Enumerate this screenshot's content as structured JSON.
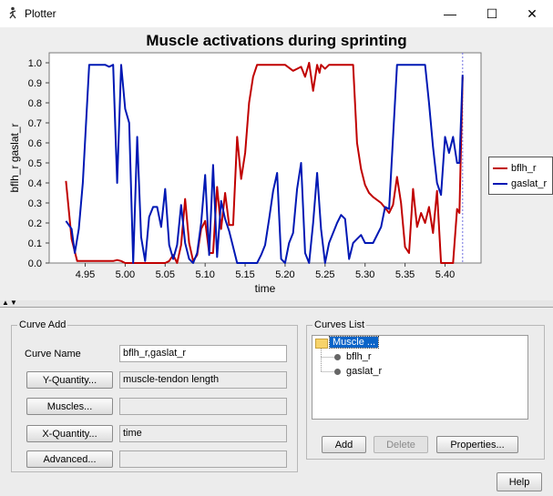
{
  "window": {
    "title": "Plotter",
    "minimize": "—",
    "maximize": "☐",
    "close": "✕"
  },
  "chart_data": {
    "type": "line",
    "title": "Muscle activations during sprinting",
    "xlabel": "time",
    "ylabel": "bflh_r gaslat_r",
    "xlim": [
      4.905,
      5.445
    ],
    "ylim": [
      0,
      1.05
    ],
    "xticks": [
      "4.95",
      "5.00",
      "5.05",
      "5.10",
      "5.15",
      "5.20",
      "5.25",
      "5.30",
      "5.35",
      "5.40"
    ],
    "yticks": [
      "0.0",
      "0.1",
      "0.2",
      "0.3",
      "0.4",
      "0.5",
      "0.6",
      "0.7",
      "0.8",
      "0.9",
      "1.0"
    ],
    "legend_position": "right",
    "cursor_x": 5.422,
    "series": [
      {
        "name": "bflh_r",
        "color": "#c00000",
        "x": [
          4.926,
          4.933,
          4.94,
          4.955,
          4.97,
          4.98,
          4.985,
          4.99,
          4.995,
          5.0,
          5.01,
          5.02,
          5.03,
          5.04,
          5.05,
          5.055,
          5.06,
          5.065,
          5.07,
          5.075,
          5.08,
          5.085,
          5.09,
          5.095,
          5.1,
          5.105,
          5.11,
          5.115,
          5.12,
          5.125,
          5.13,
          5.135,
          5.14,
          5.145,
          5.15,
          5.155,
          5.16,
          5.165,
          5.17,
          5.2,
          5.21,
          5.215,
          5.22,
          5.225,
          5.23,
          5.235,
          5.24,
          5.243,
          5.245,
          5.25,
          5.255,
          5.26,
          5.265,
          5.27,
          5.275,
          5.285,
          5.29,
          5.295,
          5.3,
          5.305,
          5.31,
          5.32,
          5.33,
          5.335,
          5.34,
          5.345,
          5.35,
          5.355,
          5.36,
          5.365,
          5.37,
          5.375,
          5.38,
          5.385,
          5.39,
          5.395,
          5.4,
          5.405,
          5.41,
          5.415,
          5.418,
          5.422
        ],
        "y": [
          0.41,
          0.12,
          0.01,
          0.01,
          0.01,
          0.01,
          0.01,
          0.015,
          0.01,
          0.0,
          0.0,
          0.0,
          0.0,
          0.0,
          0.0,
          0.01,
          0.04,
          0.0,
          0.09,
          0.32,
          0.1,
          0.01,
          0.04,
          0.17,
          0.21,
          0.05,
          0.05,
          0.38,
          0.17,
          0.35,
          0.19,
          0.19,
          0.63,
          0.42,
          0.55,
          0.8,
          0.93,
          0.99,
          0.99,
          0.99,
          0.96,
          0.97,
          0.98,
          0.93,
          1.0,
          0.86,
          0.99,
          0.95,
          0.99,
          0.97,
          0.99,
          0.99,
          0.99,
          0.99,
          0.99,
          0.99,
          0.6,
          0.47,
          0.39,
          0.35,
          0.33,
          0.3,
          0.25,
          0.29,
          0.43,
          0.3,
          0.08,
          0.05,
          0.37,
          0.18,
          0.25,
          0.2,
          0.28,
          0.15,
          0.36,
          0.0,
          0.0,
          0.0,
          0.0,
          0.27,
          0.25,
          0.93
        ]
      },
      {
        "name": "gaslat_r",
        "color": "#0018b4",
        "x": [
          4.926,
          4.933,
          4.937,
          4.942,
          4.947,
          4.955,
          4.96,
          4.965,
          4.97,
          4.975,
          4.98,
          4.985,
          4.99,
          4.995,
          5.0,
          5.005,
          5.01,
          5.015,
          5.02,
          5.025,
          5.03,
          5.035,
          5.04,
          5.045,
          5.05,
          5.055,
          5.06,
          5.065,
          5.07,
          5.075,
          5.08,
          5.085,
          5.09,
          5.095,
          5.1,
          5.105,
          5.11,
          5.115,
          5.12,
          5.125,
          5.13,
          5.135,
          5.14,
          5.145,
          5.15,
          5.155,
          5.16,
          5.165,
          5.17,
          5.175,
          5.18,
          5.185,
          5.19,
          5.195,
          5.2,
          5.205,
          5.21,
          5.215,
          5.22,
          5.225,
          5.23,
          5.235,
          5.24,
          5.245,
          5.25,
          5.255,
          5.26,
          5.265,
          5.27,
          5.275,
          5.28,
          5.285,
          5.29,
          5.295,
          5.3,
          5.31,
          5.32,
          5.325,
          5.33,
          5.34,
          5.35,
          5.355,
          5.36,
          5.365,
          5.37,
          5.375,
          5.38,
          5.385,
          5.39,
          5.395,
          5.4,
          5.405,
          5.41,
          5.415,
          5.418,
          5.422
        ],
        "y": [
          0.21,
          0.17,
          0.05,
          0.17,
          0.4,
          0.99,
          0.99,
          0.99,
          0.99,
          0.99,
          0.98,
          0.99,
          0.4,
          0.99,
          0.77,
          0.7,
          0.0,
          0.63,
          0.13,
          0.01,
          0.23,
          0.28,
          0.28,
          0.18,
          0.37,
          0.09,
          0.02,
          0.09,
          0.29,
          0.1,
          0.02,
          0.0,
          0.05,
          0.2,
          0.44,
          0.04,
          0.49,
          0.03,
          0.31,
          0.22,
          0.16,
          0.08,
          0.0,
          0.0,
          0.0,
          0.0,
          0.0,
          0.0,
          0.04,
          0.09,
          0.22,
          0.36,
          0.45,
          0.02,
          0.0,
          0.1,
          0.15,
          0.37,
          0.5,
          0.05,
          0.0,
          0.2,
          0.45,
          0.17,
          0.0,
          0.1,
          0.15,
          0.2,
          0.24,
          0.22,
          0.02,
          0.1,
          0.12,
          0.14,
          0.1,
          0.1,
          0.18,
          0.28,
          0.27,
          0.99,
          0.99,
          0.99,
          0.99,
          0.99,
          0.99,
          0.99,
          0.8,
          0.58,
          0.4,
          0.34,
          0.63,
          0.55,
          0.63,
          0.5,
          0.5,
          0.94
        ]
      }
    ]
  },
  "splitter": {
    "up": "▲",
    "down": "▼"
  },
  "curve_add": {
    "legend": "Curve Add",
    "curve_name_label": "Curve Name",
    "curve_name_value": "bflh_r,gaslat_r",
    "y_button": "Y-Quantity...",
    "y_value": "muscle-tendon length",
    "muscles_button": "Muscles...",
    "muscles_value": "",
    "x_button": "X-Quantity...",
    "x_value": "time",
    "advanced_button": "Advanced...",
    "advanced_value": ""
  },
  "curves_list": {
    "legend": "Curves List",
    "root": "Muscle ...",
    "items": [
      "bflh_r",
      "gaslat_r"
    ],
    "add_button": "Add",
    "delete_button": "Delete",
    "properties_button": "Properties..."
  },
  "help_button": "Help"
}
